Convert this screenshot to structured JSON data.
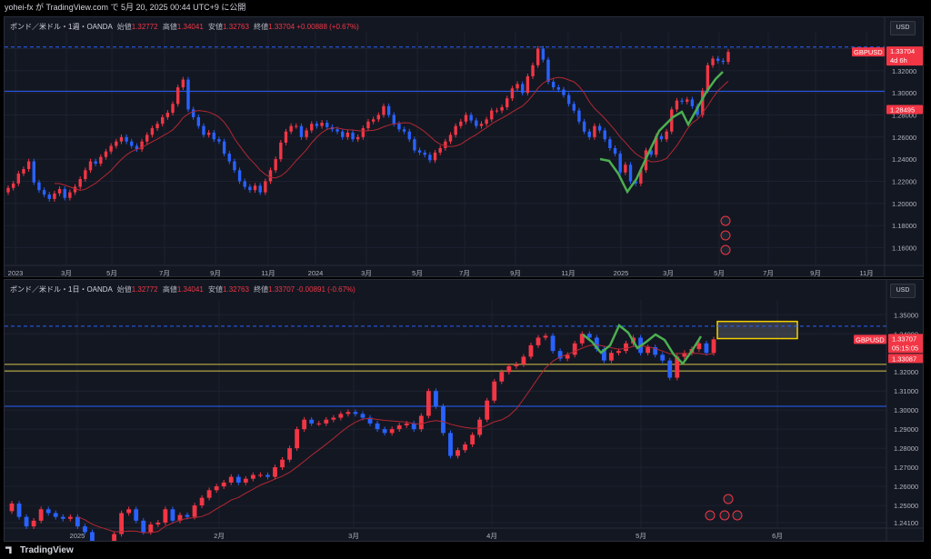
{
  "header": {
    "text": "yohei-fx が TradingView.com で 5月 20, 2025 00:44 UTC+9 に公開"
  },
  "footer": {
    "brand": "TradingView"
  },
  "colors": {
    "up": "#f23645",
    "down": "#2962ff",
    "sma": "#b22833",
    "trend": "#4caf50",
    "background": "#131722",
    "zone": "#f5d000"
  },
  "chart_data": [
    {
      "type": "candlestick",
      "title": "ポンド／米ドル・1週・OANDA",
      "currency": "USD",
      "ohlc": {
        "open_label": "始値",
        "open": "1.32772",
        "high_label": "高値",
        "high": "1.34041",
        "low_label": "安値",
        "low": "1.32763",
        "close_label": "終値",
        "close": "1.33704",
        "change": "+0.00888 (+0.67%)"
      },
      "y_ticks": [
        "1.34000",
        "1.32000",
        "1.30000",
        "1.28000",
        "1.26000",
        "1.24000",
        "1.22000",
        "1.20000",
        "1.18000",
        "1.16000"
      ],
      "y_range": [
        1.148,
        1.347
      ],
      "x_ticks": [
        "2023",
        "3月",
        "5月",
        "7月",
        "9月",
        "11月",
        "2024",
        "3月",
        "5月",
        "7月",
        "9月",
        "11月",
        "2025",
        "3月",
        "5月",
        "7月",
        "9月",
        "11月"
      ],
      "price_tags": [
        {
          "symbol": "GBPUSD",
          "price": "1.33704",
          "countdown": "4d 6h"
        },
        {
          "price": "1.28495"
        }
      ],
      "horizontal_lines": [
        1.3015
      ],
      "dashed_levels": [
        1.3415
      ],
      "closes": [
        1.214,
        1.218,
        1.227,
        1.231,
        1.238,
        1.219,
        1.212,
        1.208,
        1.204,
        1.209,
        1.213,
        1.205,
        1.21,
        1.215,
        1.222,
        1.23,
        1.238,
        1.236,
        1.242,
        1.247,
        1.252,
        1.256,
        1.26,
        1.256,
        1.252,
        1.249,
        1.256,
        1.262,
        1.268,
        1.272,
        1.278,
        1.282,
        1.29,
        1.305,
        1.312,
        1.285,
        1.278,
        1.27,
        1.262,
        1.264,
        1.258,
        1.256,
        1.245,
        1.238,
        1.23,
        1.22,
        1.215,
        1.212,
        1.216,
        1.21,
        1.22,
        1.23,
        1.24,
        1.255,
        1.265,
        1.27,
        1.27,
        1.26,
        1.266,
        1.272,
        1.27,
        1.273,
        1.269,
        1.267,
        1.265,
        1.26,
        1.264,
        1.258,
        1.26,
        1.268,
        1.274,
        1.276,
        1.28,
        1.288,
        1.28,
        1.272,
        1.267,
        1.265,
        1.258,
        1.248,
        1.246,
        1.244,
        1.239,
        1.246,
        1.25,
        1.256,
        1.262,
        1.27,
        1.274,
        1.28,
        1.275,
        1.27,
        1.272,
        1.276,
        1.284,
        1.284,
        1.287,
        1.295,
        1.304,
        1.308,
        1.3,
        1.315,
        1.325,
        1.34,
        1.33,
        1.31,
        1.305,
        1.303,
        1.298,
        1.29,
        1.284,
        1.274,
        1.265,
        1.26,
        1.27,
        1.266,
        1.258,
        1.25,
        1.245,
        1.228,
        1.235,
        1.22,
        1.218,
        1.23,
        1.248,
        1.244,
        1.261,
        1.258,
        1.265,
        1.285,
        1.293,
        1.292,
        1.294,
        1.288,
        1.28,
        1.302,
        1.325,
        1.331,
        1.329,
        1.328,
        1.337
      ]
    },
    {
      "type": "candlestick",
      "title": "ポンド／米ドル・1日・OANDA",
      "currency": "USD",
      "ohlc": {
        "open_label": "始値",
        "open": "1.32772",
        "high_label": "高値",
        "high": "1.34041",
        "low_label": "安値",
        "low": "1.32763",
        "close_label": "終値",
        "close": "1.33707",
        "change": "-0.00891 (-0.67%)"
      },
      "y_ticks": [
        "1.35000",
        "1.34000",
        "1.32000",
        "1.31000",
        "1.30000",
        "1.29000",
        "1.28000",
        "1.27000",
        "1.26000",
        "1.25000",
        "1.24100"
      ],
      "y_range": [
        1.2405,
        1.353
      ],
      "x_ticks": [
        "2025",
        "2月",
        "3月",
        "4月",
        "5月",
        "6月"
      ],
      "price_tags": [
        {
          "symbol": "GBPUSD",
          "price": "1.33707",
          "countdown": "05:15:05"
        },
        {
          "price": "1.33087"
        }
      ],
      "horizontal_lines": [
        1.302
      ],
      "support_lines": [
        1.324,
        1.3205
      ],
      "dashed_levels": [
        1.344
      ],
      "zone": {
        "from": 1.3375,
        "to": 1.3465
      },
      "closes": [
        1.251,
        1.244,
        1.239,
        1.242,
        1.248,
        1.246,
        1.244,
        1.243,
        1.244,
        1.239,
        1.236,
        1.22,
        1.225,
        1.23,
        1.235,
        1.246,
        1.248,
        1.242,
        1.236,
        1.24,
        1.241,
        1.248,
        1.242,
        1.245,
        1.244,
        1.25,
        1.254,
        1.258,
        1.26,
        1.262,
        1.265,
        1.262,
        1.264,
        1.266,
        1.266,
        1.265,
        1.27,
        1.274,
        1.28,
        1.29,
        1.295,
        1.293,
        1.293,
        1.295,
        1.296,
        1.298,
        1.299,
        1.298,
        1.296,
        1.293,
        1.29,
        1.288,
        1.29,
        1.292,
        1.293,
        1.29,
        1.297,
        1.31,
        1.302,
        1.288,
        1.276,
        1.279,
        1.282,
        1.287,
        1.295,
        1.305,
        1.315,
        1.32,
        1.323,
        1.324,
        1.328,
        1.334,
        1.338,
        1.339,
        1.331,
        1.327,
        1.329,
        1.335,
        1.34,
        1.338,
        1.332,
        1.326,
        1.33,
        1.331,
        1.335,
        1.338,
        1.33,
        1.333,
        1.329,
        1.326,
        1.317,
        1.328,
        1.33,
        1.332,
        1.335,
        1.33,
        1.3371
      ]
    }
  ]
}
